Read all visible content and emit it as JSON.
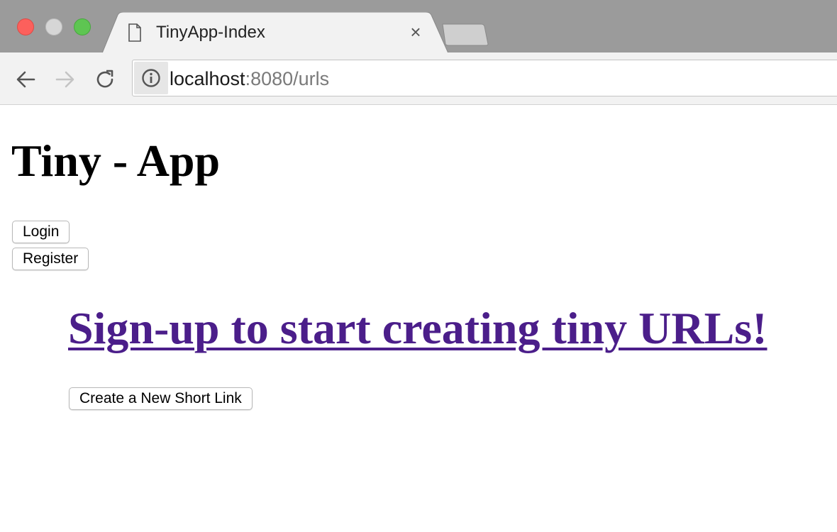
{
  "browser": {
    "tab": {
      "title": "TinyApp-Index"
    },
    "address_bar": {
      "host": "localhost",
      "rest": ":8080/urls"
    },
    "icons": {
      "close_tab": "×"
    },
    "colors": {
      "close": "#fc605c",
      "minimize": "#d6d6d6",
      "zoom": "#5ec552"
    }
  },
  "page": {
    "title": "Tiny - App",
    "buttons": {
      "login": "Login",
      "register": "Register",
      "create": "Create a New Short Link"
    },
    "signup_link": "Sign-up to start creating tiny URLs!",
    "colors": {
      "link": "#4b1e8a"
    }
  }
}
